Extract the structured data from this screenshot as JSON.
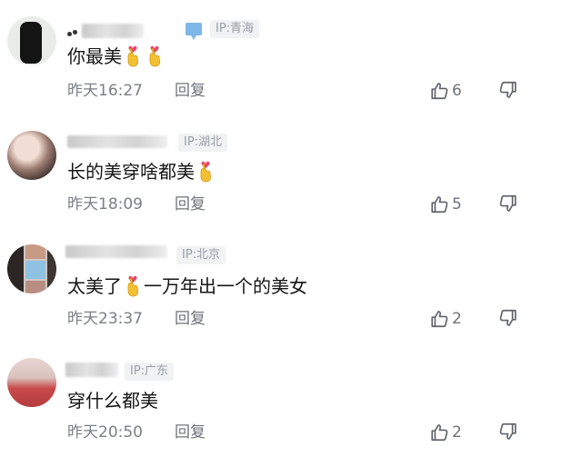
{
  "comments": [
    {
      "ip": "IP:青海",
      "text_parts": [
        "你最美",
        "",
        ""
      ],
      "time": "昨天16:27",
      "reply": "回复",
      "likes": "6"
    },
    {
      "ip": "IP:湖北",
      "text_parts": [
        "长的美穿啥都美",
        ""
      ],
      "time": "昨天18:09",
      "reply": "回复",
      "likes": "5"
    },
    {
      "ip": "IP:北京",
      "text_parts": [
        "太美了",
        "一万年出一个的美女"
      ],
      "time": "昨天23:37",
      "reply": "回复",
      "likes": "2"
    },
    {
      "ip": "IP:广东",
      "text_parts": [
        "穿什么都美"
      ],
      "time": "昨天20:50",
      "reply": "回复",
      "likes": "2"
    }
  ],
  "icons": {
    "like": "thumbs-up-icon",
    "dislike": "thumbs-down-icon",
    "emoji": "finger-heart-emoji"
  }
}
